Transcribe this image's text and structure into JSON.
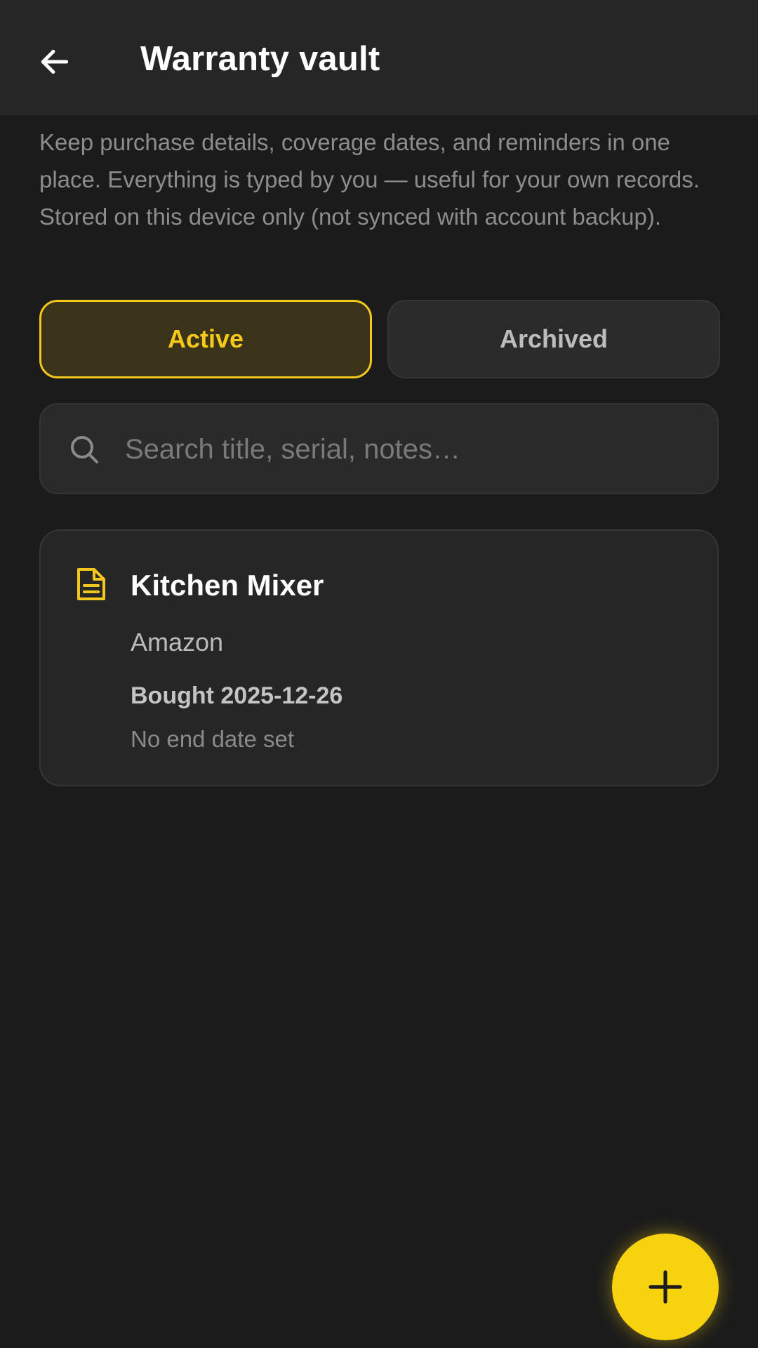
{
  "header": {
    "back_icon": "arrow-left-icon",
    "title": "Warranty vault"
  },
  "intro": "Keep purchase details, coverage dates, and reminders in one place. Everything is typed by you — useful for your own records. Stored on this device only (not synced with account backup).",
  "tabs": [
    {
      "label": "Active",
      "selected": true
    },
    {
      "label": "Archived",
      "selected": false
    }
  ],
  "search": {
    "icon": "search-icon",
    "placeholder": "Search title, serial, notes…",
    "value": ""
  },
  "warranties": [
    {
      "icon": "document-icon",
      "title": "Kitchen Mixer",
      "store": "Amazon",
      "bought": "Bought 2025-12-26",
      "end": "No end date set"
    }
  ],
  "fab": {
    "icon": "plus-icon"
  },
  "colors": {
    "background": "#1b1b1b",
    "app_bar": "#262626",
    "accent": "#f8d20f",
    "active_tab_bg": "#3a331a",
    "card_bg": "#262626"
  }
}
